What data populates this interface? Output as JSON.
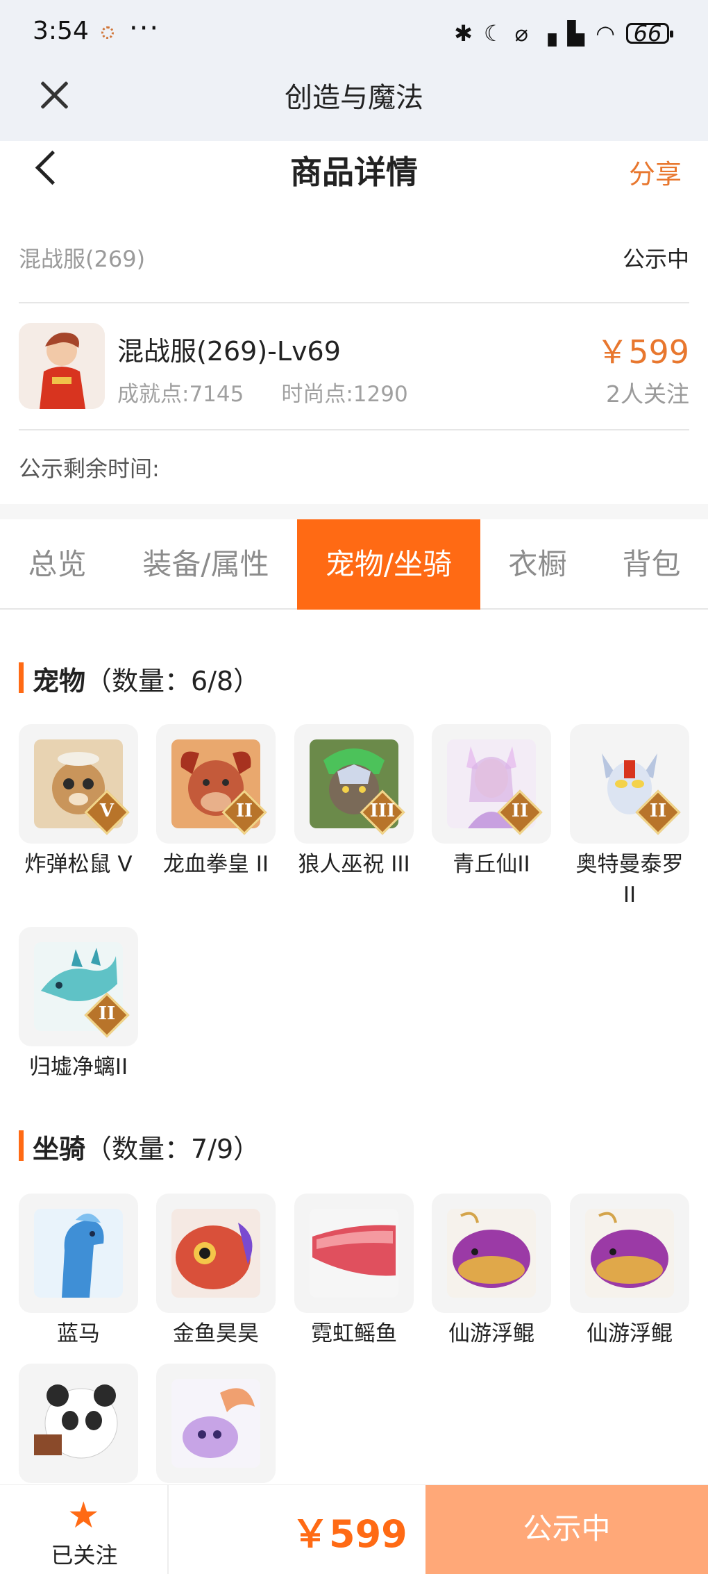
{
  "status_bar": {
    "time": "3:54",
    "dots": "···",
    "battery": "66",
    "icons": [
      "bluetooth-icon",
      "moon-icon",
      "mute-icon",
      "signal-icon",
      "hd-signal-icon",
      "wifi-icon",
      "battery-icon"
    ]
  },
  "app_bar": {
    "title": "创造与魔法"
  },
  "header": {
    "title": "商品详情",
    "share_label": "分享"
  },
  "server": {
    "name": "混战服(269)",
    "status": "公示中"
  },
  "product": {
    "name": "混战服(269)-Lv69",
    "achievement": "成就点:7145",
    "fashion": "时尚点:1290",
    "price": "￥599",
    "followers": "2人关注"
  },
  "remaining_label": "公示剩余时间:",
  "tabs": [
    {
      "label": "总览",
      "active": false
    },
    {
      "label": "装备/属性",
      "active": false
    },
    {
      "label": "宠物/坐骑",
      "active": true
    },
    {
      "label": "衣橱",
      "active": false
    },
    {
      "label": "背包",
      "active": false
    }
  ],
  "pets": {
    "title": "宠物",
    "count": "（数量：6/8）",
    "items": [
      {
        "name": "炸弹松鼠 V",
        "rank": "V",
        "color": "#c9955b"
      },
      {
        "name": "龙血拳皇 II",
        "rank": "II",
        "color": "#c45a3a"
      },
      {
        "name": "狼人巫祝 III",
        "rank": "III",
        "color": "#7a6a58"
      },
      {
        "name": "青丘仙II",
        "rank": "II",
        "color": "#d9b3e6"
      },
      {
        "name": "奥特曼泰罗II",
        "rank": "II",
        "color": "#b8c6e0"
      },
      {
        "name": "归墟净螭II",
        "rank": "II",
        "color": "#5fc2c6"
      }
    ]
  },
  "mounts": {
    "title": "坐骑",
    "count": "（数量：7/9）",
    "items": [
      {
        "name": "蓝马",
        "color": "#3f8fd6"
      },
      {
        "name": "金鱼昊昊",
        "color": "#d9503a"
      },
      {
        "name": "霓虹鳐鱼",
        "color": "#e0505e"
      },
      {
        "name": "仙游浮鲲",
        "color": "#9b3aa6"
      },
      {
        "name": "仙游浮鲲",
        "color": "#9b3aa6"
      },
      {
        "name": "",
        "color": "#3a3a3a"
      },
      {
        "name": "",
        "color": "#c7a4e6"
      }
    ]
  },
  "bottom": {
    "follow_label": "已关注",
    "star": "★",
    "price": "￥599",
    "status_label": "公示中"
  },
  "colors": {
    "accent": "#ff6a14",
    "price": "#e8772e",
    "status_button": "#ffa878"
  }
}
